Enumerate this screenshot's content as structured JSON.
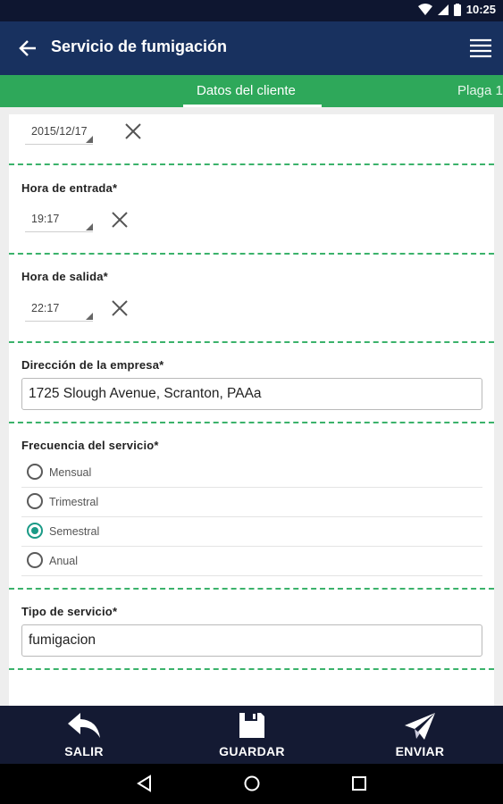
{
  "status": {
    "time": "10:25"
  },
  "appbar": {
    "title": "Servicio de fumigación"
  },
  "tabs": [
    {
      "label": "Datos del cliente",
      "selected": true
    },
    {
      "label": "Plaga 1"
    }
  ],
  "form": {
    "date": {
      "value": "2015/12/17"
    },
    "entry_time": {
      "label": "Hora de entrada*",
      "value": "19:17"
    },
    "exit_time": {
      "label": "Hora de salida*",
      "value": "22:17"
    },
    "address": {
      "label": "Dirección de la empresa*",
      "value": "1725 Slough Avenue, Scranton, PAAa"
    },
    "frequency": {
      "label": "Frecuencia del servicio*",
      "options": [
        "Mensual",
        "Trimestral",
        "Semestral",
        "Anual"
      ],
      "selected": "Semestral"
    },
    "service_type": {
      "label": "Tipo de servicio*",
      "value": "fumigacion"
    }
  },
  "actions": {
    "exit": "SALIR",
    "save": "GUARDAR",
    "send": "ENVIAR"
  },
  "colors": {
    "appbar": "#18315f",
    "tabbar": "#2ea85a",
    "bottombar": "#141a33",
    "accent": "#1a9a86"
  }
}
